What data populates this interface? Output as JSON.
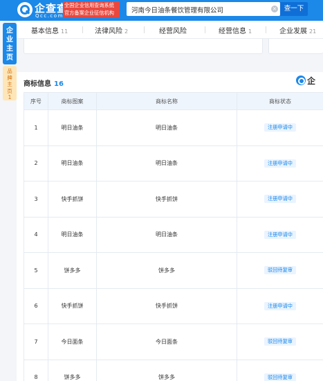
{
  "header": {
    "logo_text": "企查查",
    "logo_domain": "Qcc.com",
    "badge_line1": "全国企业信用查询系统",
    "badge_line2": "官方备案企业征信机构",
    "search_value": "河南今日油条餐饮管理有限公司",
    "search_button": "查一下"
  },
  "side_tabs": {
    "company_home": "企业主页",
    "brand_home": "品牌主页",
    "brand_count": "1"
  },
  "nav": {
    "items": [
      {
        "label": "基本信息",
        "count": "11"
      },
      {
        "label": "法律风险",
        "count": "2"
      },
      {
        "label": "经营风险",
        "count": ""
      },
      {
        "label": "经营信息",
        "count": "1"
      },
      {
        "label": "企业发展",
        "count": "21"
      }
    ]
  },
  "trademark": {
    "title": "商标信息",
    "count": "16",
    "watermark": "企",
    "columns": [
      "序号",
      "商标图案",
      "商标名称",
      "商标状态"
    ],
    "rows": [
      {
        "no": "1",
        "image": "明日油条",
        "name": "明日油条",
        "status": "注册申请中",
        "status_type": "pending"
      },
      {
        "no": "2",
        "image": "明日油条",
        "name": "明日油条",
        "status": "注册申请中",
        "status_type": "pending"
      },
      {
        "no": "3",
        "image": "快手抓饼",
        "name": "快手抓饼",
        "status": "注册申请中",
        "status_type": "pending"
      },
      {
        "no": "4",
        "image": "明日油条",
        "name": "明日油条",
        "status": "注册申请中",
        "status_type": "pending"
      },
      {
        "no": "5",
        "image": "饼多多",
        "name": "饼多多",
        "status": "驳回待复审",
        "status_type": "rejected"
      },
      {
        "no": "6",
        "image": "快手抓饼",
        "name": "快手抓饼",
        "status": "注册申请中",
        "status_type": "pending"
      },
      {
        "no": "7",
        "image": "今日面条",
        "name": "今日面条",
        "status": "驳回待复审",
        "status_type": "rejected"
      },
      {
        "no": "8",
        "image": "饼多多",
        "name": "饼多多",
        "status": "驳回待复审",
        "status_type": "rejected"
      }
    ]
  },
  "colors": {
    "brand_blue": "#1c88e8",
    "badge_red": "#e8483f",
    "brand_tab_bg": "#ffe6b8"
  }
}
